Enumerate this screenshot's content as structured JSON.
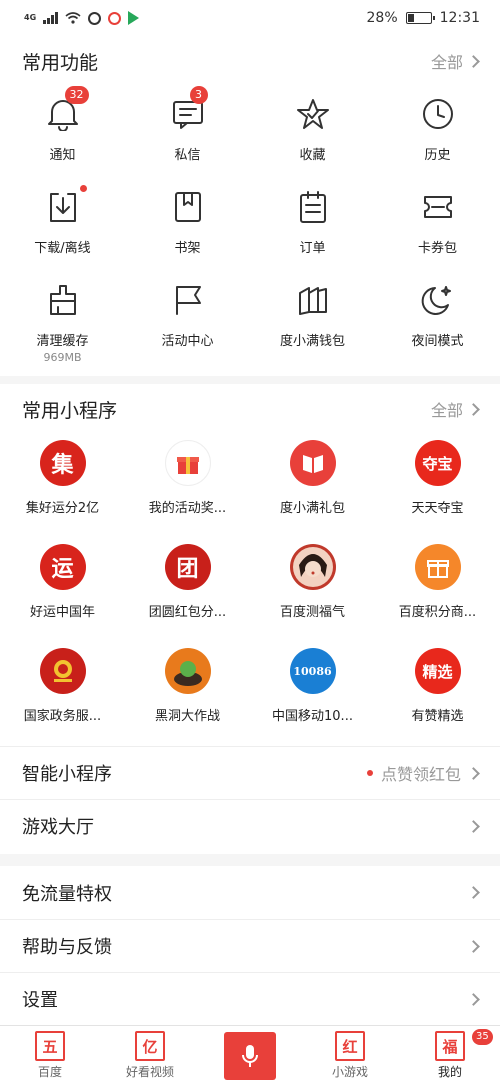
{
  "status_bar": {
    "network": "4G",
    "battery": "28%",
    "battery_level": 0.28,
    "time": "12:31"
  },
  "common_functions": {
    "title": "常用功能",
    "more": "全部",
    "items": [
      {
        "label": "通知",
        "icon": "bell-icon",
        "badge": "32"
      },
      {
        "label": "私信",
        "icon": "message-icon",
        "badge": "3"
      },
      {
        "label": "收藏",
        "icon": "star-icon"
      },
      {
        "label": "历史",
        "icon": "clock-icon"
      },
      {
        "label": "下载/离线",
        "icon": "download-icon",
        "dot": true
      },
      {
        "label": "书架",
        "icon": "bookmark-icon"
      },
      {
        "label": "订单",
        "icon": "order-icon"
      },
      {
        "label": "卡券包",
        "icon": "ticket-icon"
      },
      {
        "label": "清理缓存",
        "icon": "broom-icon",
        "sub": "969MB"
      },
      {
        "label": "活动中心",
        "icon": "flag-icon"
      },
      {
        "label": "度小满钱包",
        "icon": "wallet-icon"
      },
      {
        "label": "夜间模式",
        "icon": "moon-icon"
      }
    ]
  },
  "mini_programs": {
    "title": "常用小程序",
    "more": "全部",
    "items": [
      {
        "label": "集好运分2亿",
        "icon": "ji-fu-icon",
        "glyph": "集",
        "color": "#d8241c"
      },
      {
        "label": "我的活动奖...",
        "icon": "gift-icon",
        "color": "#ffffff"
      },
      {
        "label": "度小满礼包",
        "icon": "book-logo-icon",
        "color": "#e8403a"
      },
      {
        "label": "天天夺宝",
        "icon": "duobao-icon",
        "glyph": "夺宝",
        "color": "#e8281c"
      },
      {
        "label": "好运中国年",
        "icon": "yun-icon",
        "glyph": "运",
        "color": "#d8241c"
      },
      {
        "label": "团圆红包分...",
        "icon": "tuan-icon",
        "glyph": "团",
        "color": "#c8201a"
      },
      {
        "label": "百度测福气",
        "icon": "portrait-icon",
        "color": "#c0392b"
      },
      {
        "label": "百度积分商...",
        "icon": "gift-box-icon",
        "color": "#f5872a"
      },
      {
        "label": "国家政务服...",
        "icon": "emblem-icon",
        "color": "#c8201a"
      },
      {
        "label": "黑洞大作战",
        "icon": "game-icon",
        "color": "#e87a1c"
      },
      {
        "label": "中国移动10...",
        "icon": "china-mobile-icon",
        "glyph": "10086",
        "color": "#1a7fd4"
      },
      {
        "label": "有赞精选",
        "icon": "youzan-icon",
        "glyph": "精选",
        "color": "#e8281c"
      }
    ]
  },
  "rows_group1": [
    {
      "label": "智能小程序",
      "right": "点赞领红包",
      "dot": true
    },
    {
      "label": "游戏大厅",
      "right": ""
    }
  ],
  "rows_group2": [
    {
      "label": "免流量特权"
    },
    {
      "label": "帮助与反馈"
    },
    {
      "label": "设置"
    }
  ],
  "tabbar": {
    "tabs": [
      {
        "label": "百度",
        "glyph": "五"
      },
      {
        "label": "好看视频",
        "glyph": "亿"
      },
      {
        "label": "",
        "mic": true
      },
      {
        "label": "小游戏",
        "glyph": "红"
      },
      {
        "label": "我的",
        "glyph": "福",
        "badge": "35",
        "active": true
      }
    ]
  }
}
